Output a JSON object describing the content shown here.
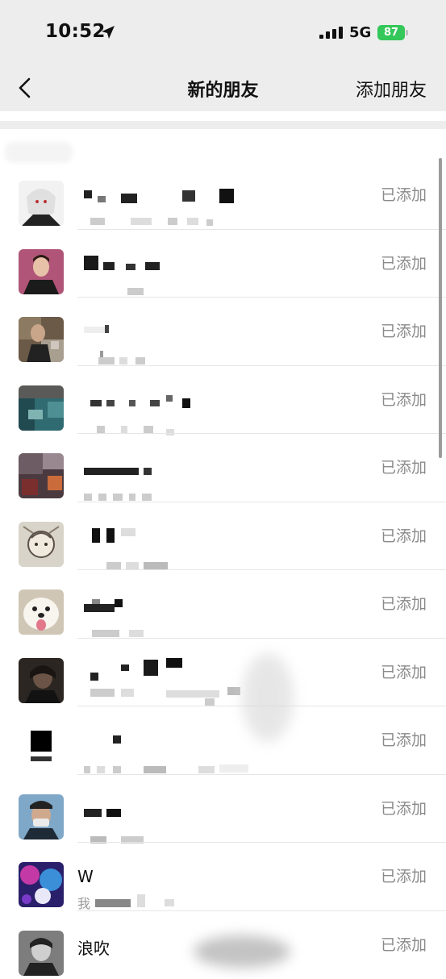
{
  "status_bar": {
    "time": "10:52",
    "network": "5G",
    "battery": "87"
  },
  "nav": {
    "title": "新的朋友",
    "action": "添加朋友"
  },
  "rows": [
    {
      "status": "已添加",
      "name": "",
      "message": ""
    },
    {
      "status": "已添加",
      "name": "",
      "message": ""
    },
    {
      "status": "已添加",
      "name": "",
      "message": ""
    },
    {
      "status": "已添加",
      "name": "",
      "message": ""
    },
    {
      "status": "已添加",
      "name": "",
      "message": ""
    },
    {
      "status": "已添加",
      "name": "",
      "message": ""
    },
    {
      "status": "已添加",
      "name": "",
      "message": ""
    },
    {
      "status": "已添加",
      "name": "",
      "message": ""
    },
    {
      "status": "已添加",
      "name": "",
      "message": ""
    },
    {
      "status": "已添加",
      "name": "",
      "message": ""
    },
    {
      "status": "已添加",
      "name": "W",
      "message": "我"
    },
    {
      "status": "已添加",
      "name": "浪吹",
      "message": ""
    }
  ],
  "colors": {
    "header_bg": "#ededed",
    "status_gray": "#8a8a8a",
    "battery_green": "#34c759"
  }
}
